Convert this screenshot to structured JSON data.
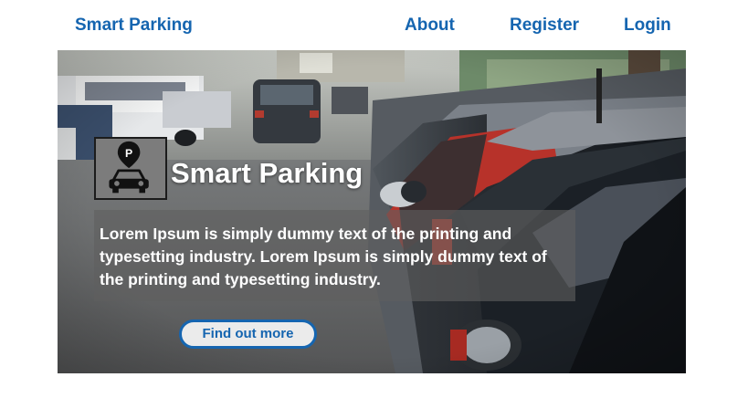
{
  "nav": {
    "brand": "Smart Parking",
    "links": [
      {
        "label": "About"
      },
      {
        "label": "Register"
      },
      {
        "label": "Login"
      }
    ]
  },
  "hero": {
    "title": "Smart Parking",
    "logo_icon": "parking-car-pin-icon",
    "description": "Lorem Ipsum is simply dummy text of the printing and typesetting industry. Lorem Ipsum is simply dummy text of the printing and typesetting industry.",
    "cta_label": "Find out more",
    "background_image": "parked-cars-street-photo"
  },
  "colors": {
    "link": "#1565b0",
    "overlay": "#5f5f5f"
  }
}
